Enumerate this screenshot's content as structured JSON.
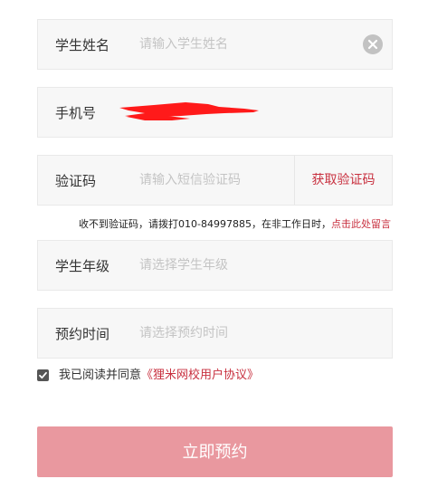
{
  "form": {
    "name": {
      "label": "学生姓名",
      "placeholder": "请输入学生姓名",
      "clear_icon": "close-circle-icon"
    },
    "phone": {
      "label": "手机号",
      "value_redacted": true,
      "redaction_color": "#ff1a1a"
    },
    "code": {
      "label": "验证码",
      "placeholder": "请输入短信验证码",
      "button_label": "获取验证码"
    },
    "hint": {
      "text": "收不到验证码，请拨打010-84997885，在非工作日时，",
      "link": "点击此处留言"
    },
    "grade": {
      "label": "学生年级",
      "placeholder": "请选择学生年级"
    },
    "time": {
      "label": "预约时间",
      "placeholder": "请选择预约时间"
    },
    "agreement": {
      "checked": true,
      "text": "我已阅读并同意",
      "link": "《狸米网校用户协议》"
    },
    "submit_label": "立即预约"
  },
  "colors": {
    "accent": "#c8303f",
    "submit_bg": "#e9989f",
    "field_bg": "#f7f7f7",
    "placeholder": "#c4c4c4"
  }
}
